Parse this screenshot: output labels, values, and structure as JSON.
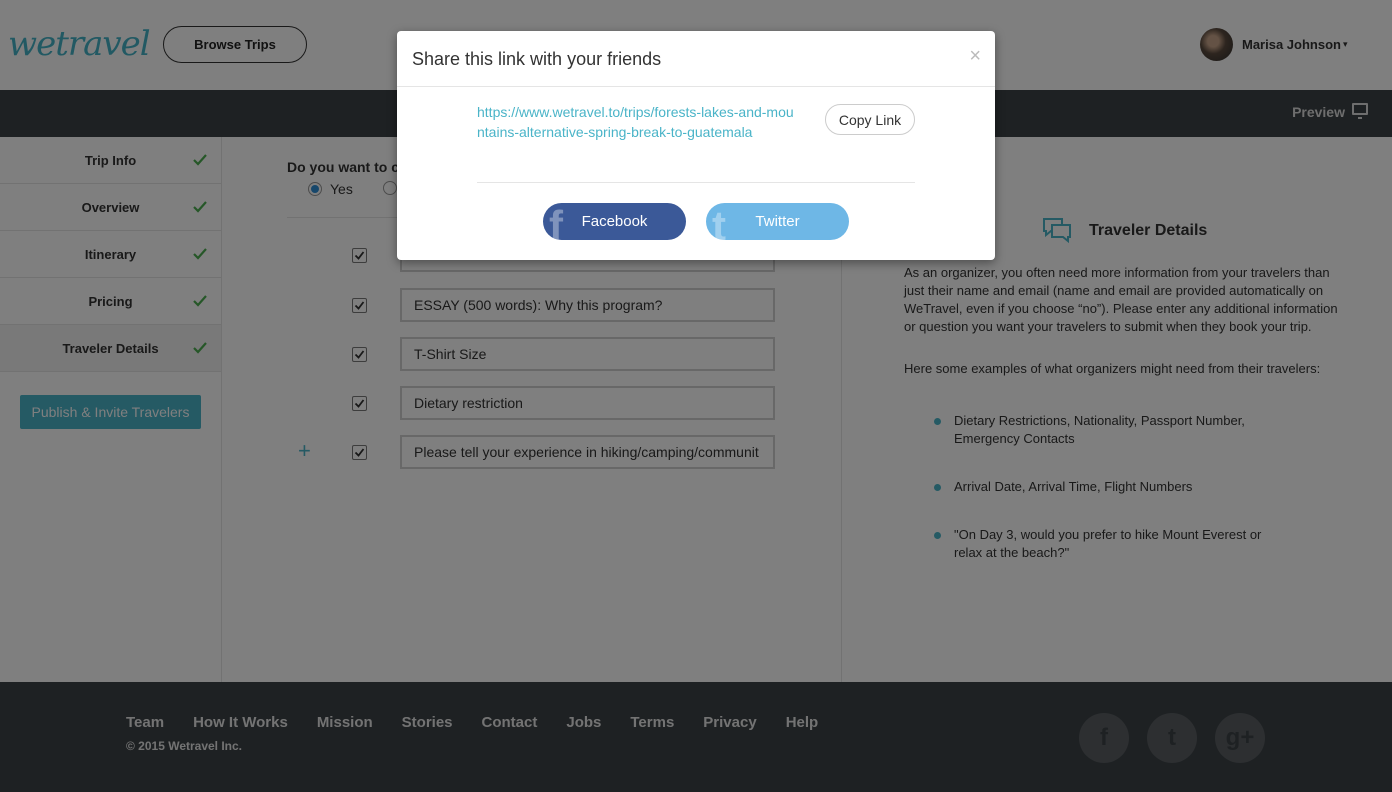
{
  "header": {
    "logo": "wetravel",
    "browse_label": "Browse Trips",
    "user_name": "Marisa Johnson",
    "caret": "▾"
  },
  "toolbar": {
    "preview_label": "Preview"
  },
  "sidebar": {
    "items": [
      {
        "label": "Trip Info"
      },
      {
        "label": "Overview"
      },
      {
        "label": "Itinerary"
      },
      {
        "label": "Pricing"
      },
      {
        "label": "Traveler Details"
      }
    ],
    "publish_label": "Publish & Invite Travelers"
  },
  "form": {
    "question": "Do you want to c",
    "yes_label": "Yes",
    "fields": [
      "",
      "ESSAY (500 words): Why this program?",
      "T-Shirt Size",
      "Dietary restriction",
      "Please tell your experience in hiking/camping/communit"
    ],
    "add_symbol": "+"
  },
  "info": {
    "title": "Traveler Details",
    "para1": "As an organizer, you often need more information from your travelers than just their name and email (name and email are provided automatically on WeTravel, even if you choose “no”). Please enter any additional information or question you want your travelers to submit when they book your trip.",
    "para2": "Here some examples of what organizers might need from their travelers:",
    "examples": [
      "Dietary Restrictions, Nationality, Passport Number, Emergency Contacts",
      "Arrival Date, Arrival Time, Flight Numbers",
      "\"On Day 3, would you prefer to hike Mount Everest or relax at the beach?\""
    ]
  },
  "footer": {
    "links": [
      "Team",
      "How It Works",
      "Mission",
      "Stories",
      "Contact",
      "Jobs",
      "Terms",
      "Privacy",
      "Help"
    ],
    "copyright": "© 2015 Wetravel Inc.",
    "social": [
      "f",
      "t",
      "g+"
    ]
  },
  "modal": {
    "title": "Share this link with your friends",
    "close": "×",
    "link": "https://www.wetravel.to/trips/forests-lakes-and-mountains-alternative-spring-break-to-guatemala",
    "copy_label": "Copy Link",
    "facebook_label": "Facebook",
    "twitter_label": "Twitter"
  },
  "colors": {
    "accent": "#4ab4c8",
    "dark_bar": "#3d4347",
    "facebook": "#3b5998",
    "twitter": "#6eb7e6",
    "check": "#4caf50"
  },
  "icons": {
    "preview": "monitor-icon",
    "check": "check-icon",
    "info": "chat-bubbles-icon",
    "close": "close-icon"
  }
}
